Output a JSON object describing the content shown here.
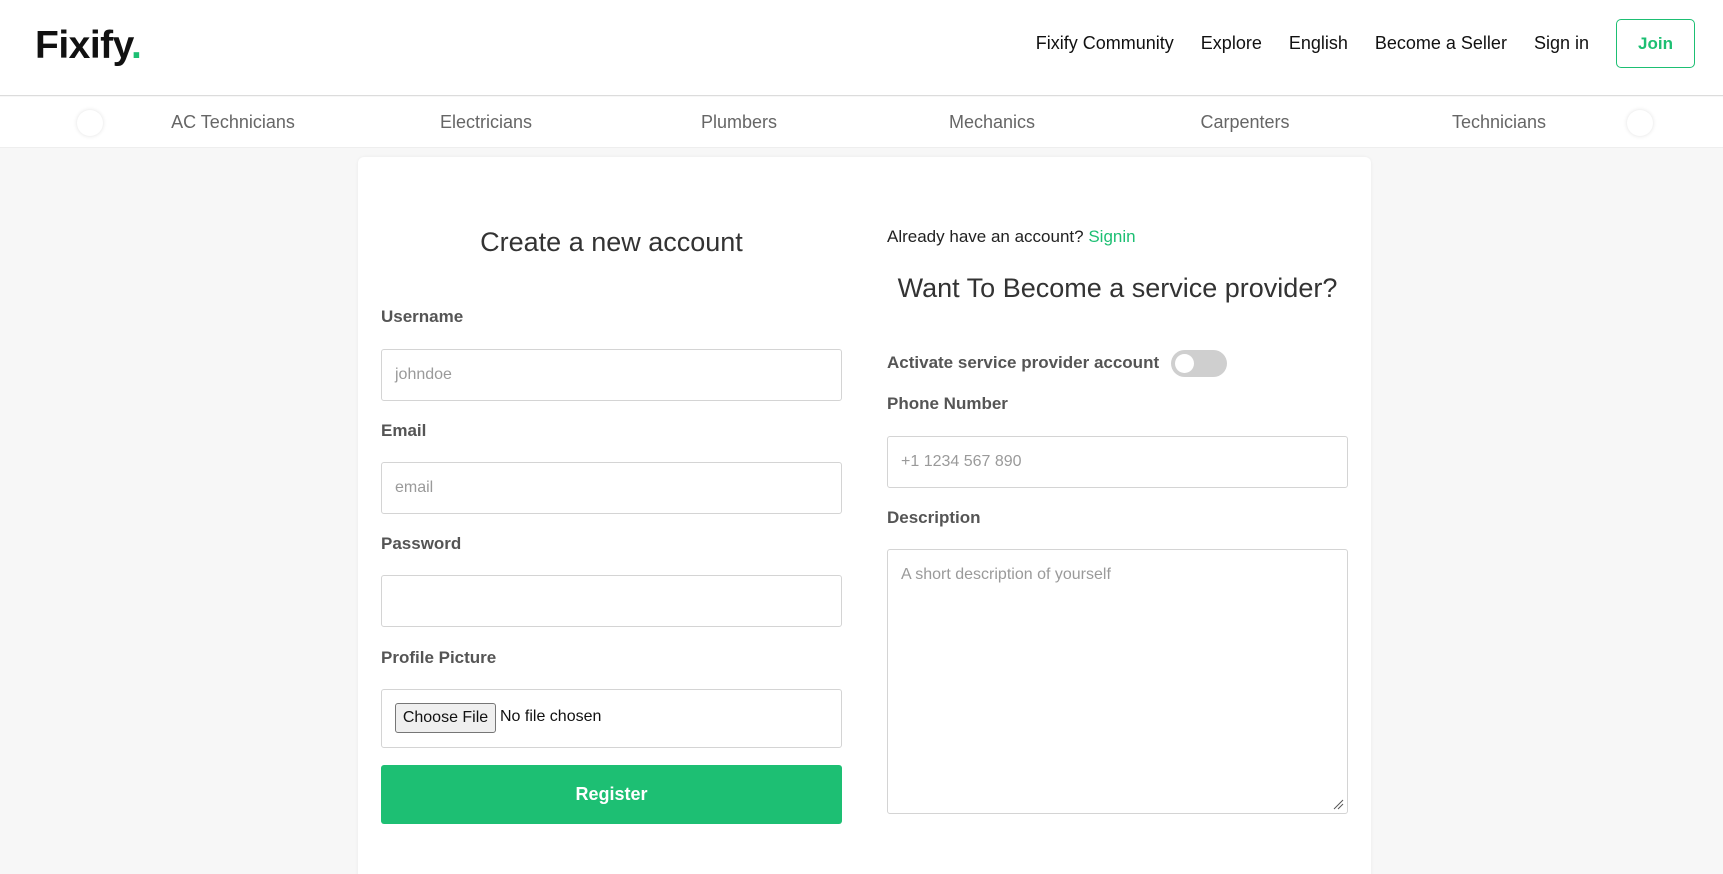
{
  "header": {
    "logo_text": "Fixify",
    "logo_dot": ".",
    "nav": [
      "Fixify Community",
      "Explore",
      "English",
      "Become a Seller",
      "Sign in"
    ],
    "join_label": "Join"
  },
  "categories": [
    "AC Technicians",
    "Electricians",
    "Plumbers",
    "Mechanics",
    "Carpenters",
    "Technicians"
  ],
  "register_form": {
    "title": "Create a new account",
    "username_label": "Username",
    "username_placeholder": "johndoe",
    "email_label": "Email",
    "email_placeholder": "email",
    "password_label": "Password",
    "profile_label": "Profile Picture",
    "choose_file_label": "Choose File",
    "file_status": "No file chosen",
    "register_label": "Register"
  },
  "provider_form": {
    "already_text": "Already have an account?",
    "signin_link": "Signin",
    "title": "Want To Become a service provider?",
    "activate_label": "Activate service provider account",
    "activate_on": false,
    "phone_label": "Phone Number",
    "phone_placeholder": "+1 1234 567 890",
    "description_label": "Description",
    "description_placeholder": "A short description of yourself"
  },
  "colors": {
    "accent": "#1dbf73",
    "page_bg": "#f7f7f7"
  }
}
